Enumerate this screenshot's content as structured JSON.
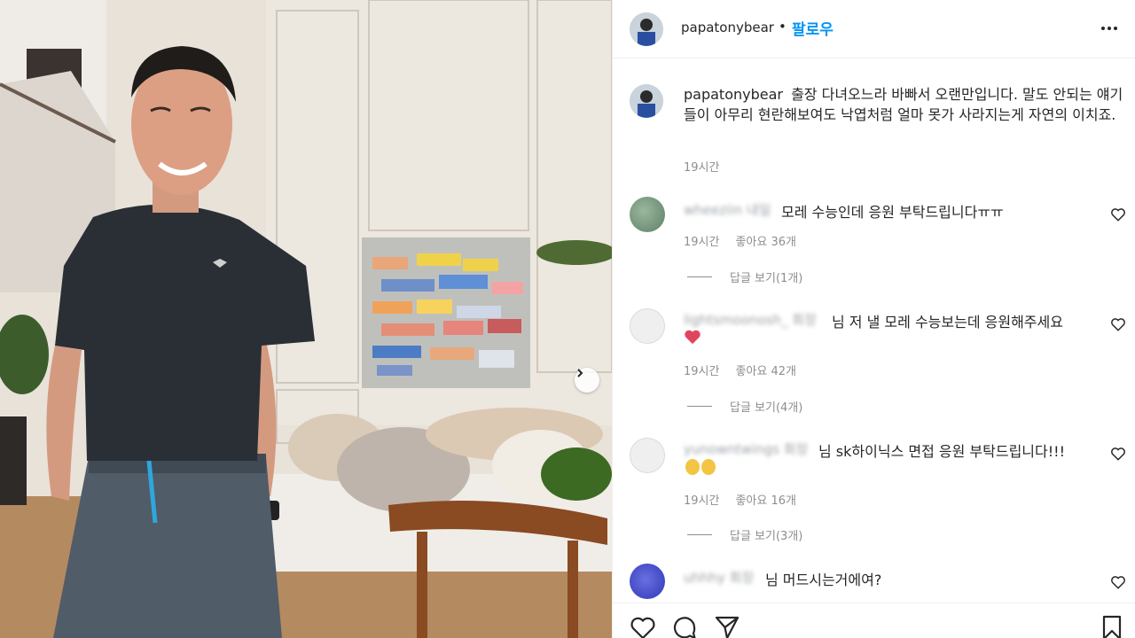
{
  "post": {
    "username": "papatonybear",
    "separator": "•",
    "follow_label": "팔로우",
    "caption_text": "출장 다녀오느라 바빠서 오랜만입니다. 말도 안되는 얘기들이 아무리 현란해보여도 낙엽처럼 얼마 못가 사라지는게 자연의 이치죠.",
    "caption_time": "19시간",
    "icons": {
      "more": "more-horizontal-icon",
      "like": "heart-icon",
      "comment": "comment-bubble-icon",
      "share": "paper-plane-icon",
      "save": "bookmark-icon",
      "next": "chevron-right-icon"
    }
  },
  "comments": [
    {
      "username": "wheeziin 내일",
      "text": "모레 수능인데 응원 부탁드립니다ㅠㅠ",
      "time": "19시간",
      "likes": "좋아요 36개",
      "replies": "답글 보기(1개)"
    },
    {
      "username": "lightsmoonosh_ 회장",
      "text": "님 저 낼 모레 수능보는데 응원해주세요",
      "time": "19시간",
      "likes": "좋아요 42개",
      "replies": "답글 보기(4개)"
    },
    {
      "username": "yunowntwings 회장",
      "text": "님 sk하이닉스 면접 응원 부탁드립니다!!!",
      "time": "19시간",
      "likes": "좋아요 16개",
      "replies": "답글 보기(3개)"
    },
    {
      "username": "uhhhy 회장",
      "text": "님 머드시는거에여?"
    }
  ],
  "colors": {
    "follow_blue": "#0095f6",
    "meta_gray": "#8e8e8e",
    "text": "#262626",
    "divider": "#efefef"
  }
}
